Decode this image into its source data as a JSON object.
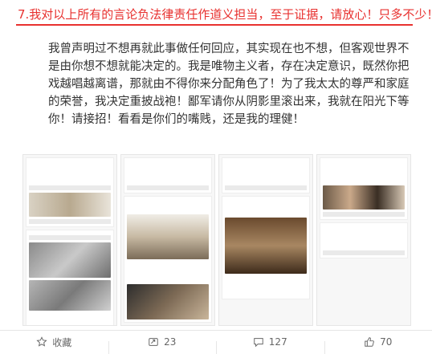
{
  "post": {
    "headline": "7.我对以上所有的言论负法律责任作道义担当，至于证据，请放心！只多不少！",
    "paragraph_1": "我曾声明过不想再就此事做任何回应，其实现在也不想，但客观世界不是由你想不想就能决定的。我是唯物主义者，存在决定意识，既然你把戏越唱越离谱，那就由不得你来分配角色了！为了我太太的尊严和家庭的荣誉，我决定重披战袍！鄙军请你从阴影里滚出来，我就在阳光下等你！请接招！看看是你们的嘴贱，还是我的理健！"
  },
  "footer": {
    "favorite_label": "收藏",
    "repost_count": "23",
    "comment_count": "127",
    "like_count": "70"
  },
  "colors": {
    "accent": "#e8312f",
    "text": "#333333",
    "muted": "#666666"
  }
}
